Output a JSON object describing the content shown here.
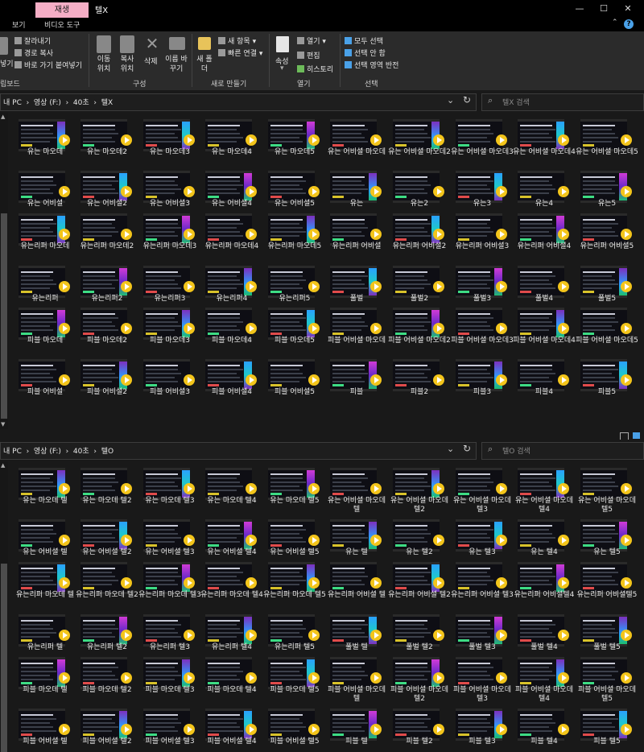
{
  "titlebar": {
    "context_tab": "재생",
    "title": "텔X",
    "minimize": "—",
    "maximize": "☐",
    "close": "✕"
  },
  "tabs": [
    "보기",
    "비디오 도구"
  ],
  "help": "?",
  "ribbon": {
    "clipboard": {
      "cut": "잘라내기",
      "copy_path": "경로 복사",
      "paste_shortcut": "바로 가기 붙여넣기",
      "label": "립보드",
      "paste_cut": "넣기"
    },
    "organize": {
      "move": "이동 위치",
      "copy": "복사 위치",
      "delete": "삭제",
      "rename": "이름 바꾸기",
      "label": "구성"
    },
    "new": {
      "folder": "새 폴더",
      "new_item": "새 항목",
      "easy_access": "빠른 연결",
      "label": "새로 만들기"
    },
    "open": {
      "properties": "속성",
      "open": "열기",
      "edit": "편집",
      "history": "히스토리",
      "label": "열기"
    },
    "select": {
      "all": "모두 선택",
      "none": "선택 안 함",
      "invert": "선택 영역 반전",
      "label": "선택"
    }
  },
  "panes": [
    {
      "path": [
        "내 PC",
        "영상 (F:)",
        "40초",
        "텔X"
      ],
      "search_placeholder": "텔X 검색",
      "rows": [
        [
          "유는 마오데",
          "유는 마오데2",
          "유는 마오데3",
          "유는 마오데4",
          "유는 마오데5",
          "유는 어비셜 마오데",
          "유는 어비셜 마오데2",
          "유는 어비셜 마오데3",
          "유는 어비셜 마오데4",
          "유는 어비셜 마오데5"
        ],
        [
          "유는 어비셜",
          "유는 어비셜2",
          "유는 어비셜3",
          "유는 어비셜4",
          "유는 어비셜5",
          "유는",
          "유는2",
          "유는3",
          "유는4",
          "유는5"
        ],
        [
          "유는리퍼 마오데",
          "유는리퍼 마오데2",
          "유는리퍼 마오데3",
          "유는리퍼 마오데4",
          "유는리퍼 마오데5",
          "유는리퍼 어비셜",
          "유는리퍼 어비셜2",
          "유는리퍼 어비셜3",
          "유는리퍼 어비셜4",
          "유는리퍼 어비셜5"
        ],
        [
          "유는리퍼",
          "유는리퍼2",
          "유는리퍼3",
          "유는리퍼4",
          "유는리퍼5",
          "풀벌",
          "풀벌2",
          "풀벌3",
          "풀벌4",
          "풀벌5"
        ],
        [
          "피블 마오데",
          "피블 마오데2",
          "피블 마오데3",
          "피블 마오데4",
          "피블 마오데5",
          "피블 어비셜 마오데",
          "피블 어비셜 마오데2",
          "피블 어비셜 마오데3",
          "피블 어비셜 마오데4",
          "피블 어비셜 마오데5"
        ],
        [
          "피블 어비셜",
          "피블 어비셜2",
          "피블 어비셜3",
          "피블 어비셜4",
          "피블 어비셜5",
          "피블",
          "피블2",
          "피블3",
          "피블4",
          "피블5"
        ]
      ]
    },
    {
      "path": [
        "내 PC",
        "영상 (F:)",
        "40초",
        "텔O"
      ],
      "search_placeholder": "텔O 검색",
      "rows": [
        [
          "유는 마오데 텔",
          "유는 마오데 텔2",
          "유는 마오데 텔3",
          "유는 마오데 텔4",
          "유는 마오데 텔5",
          "유는 어비셜 마오데 텔",
          "유는 어비셜 마오데 텔2",
          "유는 어비셜 마오데 텔3",
          "유는 어비셜 마오데 텔4",
          "유는 어비셜 마오데 텔5"
        ],
        [
          "유는 어비셜 텔",
          "유는 어비셜 텔2",
          "유는 어비셜 텔3",
          "유는 어비셜 텔4",
          "유는 어비셜 텔5",
          "유는 텔",
          "유는 텔2",
          "유는 텔3",
          "유는 텔4",
          "유는 텔5"
        ],
        [
          "유는리퍼 마오데 텔",
          "유는리퍼 마오데 텔2",
          "유는리퍼 마오데 텔3",
          "유는리퍼 마오데 텔4",
          "유는리퍼 마오데 텔5",
          "유는리퍼 어비셜 텔",
          "유는리퍼 어비셜 텔2",
          "유는리퍼 어비셜 텔3",
          "유는리퍼 어비셜텔4",
          "유는리퍼 어비셜텔5"
        ],
        [
          "유는리퍼 텔",
          "유는리퍼 텔2",
          "유는리퍼 텔3",
          "유는리퍼 텔4",
          "유는리퍼 텔5",
          "풀벌 텔",
          "풀벌 텔2",
          "풀벌 텔3",
          "풀벌 텔4",
          "풀벌 텔5"
        ],
        [
          "피블 마오데 텔",
          "피블 마오데 텔2",
          "피블 마오데 텔3",
          "피블 마오데 텔4",
          "피블 마오데 텔5",
          "피블 어비셜 마오데 텔",
          "피블 어비셜 마오데 텔2",
          "피블 어비셜 마오데 텔3",
          "피블 어비셜 마오데 텔4",
          "피블 어비셜 마오데 텔5"
        ],
        [
          "피블 어비셜 텔",
          "피블 어비셜 텔2",
          "피블 어비셜 텔3",
          "피블 어비셜 텔4",
          "피블 어비셜 텔5",
          "피블 텔",
          "피블 텔2",
          "피블 텔3",
          "피블 텔4",
          "피블 텔5"
        ]
      ]
    }
  ],
  "icons": {
    "play": "play-badge-icon",
    "refresh": "↻",
    "search": "⌕",
    "chevron": "⌄"
  },
  "colors": {
    "context_tab": "#f5aec6",
    "play_badge": "#f3c51b",
    "background": "#191919"
  }
}
